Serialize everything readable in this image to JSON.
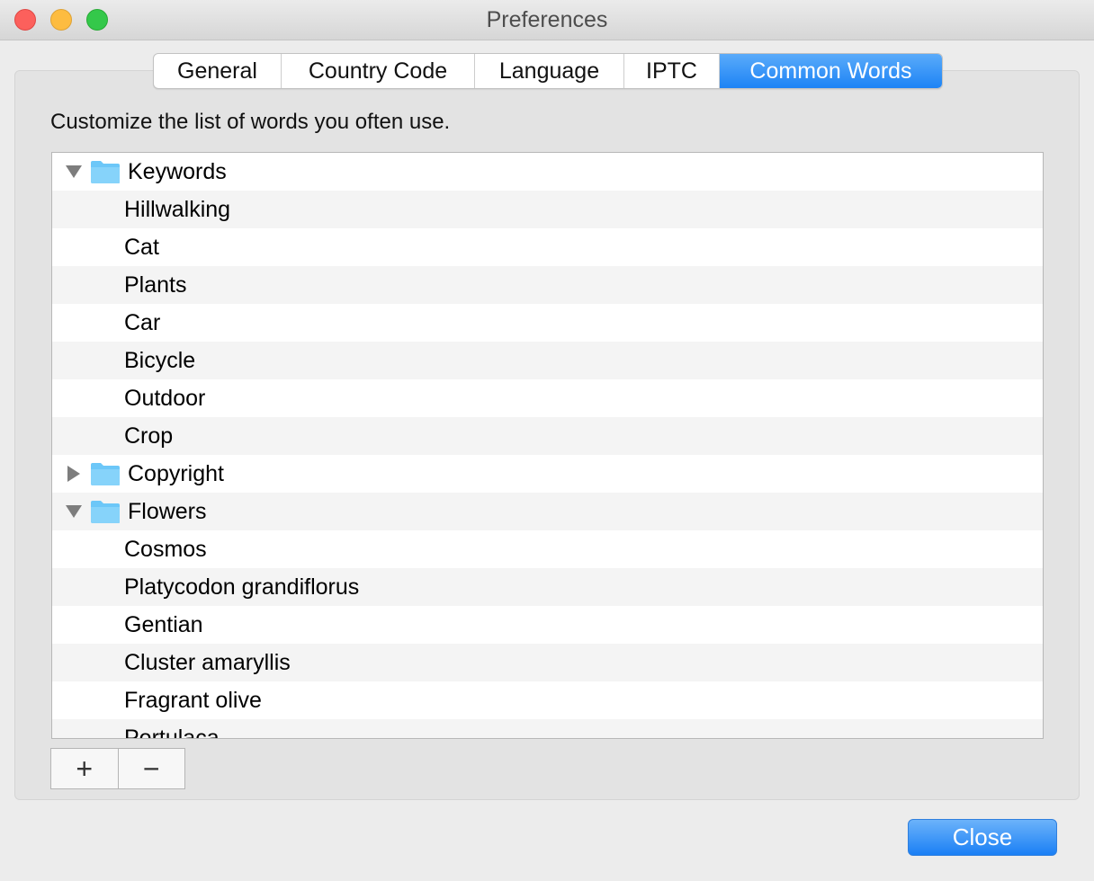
{
  "window": {
    "title": "Preferences"
  },
  "tabs": [
    {
      "label": "General"
    },
    {
      "label": "Country Code"
    },
    {
      "label": "Language"
    },
    {
      "label": "IPTC"
    },
    {
      "label": "Common Words",
      "selected": true
    }
  ],
  "description": "Customize the list of words you often use.",
  "list": {
    "groups": [
      {
        "label": "Keywords",
        "expanded": true,
        "items": [
          "Hillwalking",
          "Cat",
          "Plants",
          "Car",
          "Bicycle",
          "Outdoor",
          "Crop"
        ]
      },
      {
        "label": "Copyright",
        "expanded": false,
        "items": []
      },
      {
        "label": "Flowers",
        "expanded": true,
        "items": [
          "Cosmos",
          "Platycodon grandiflorus",
          "Gentian",
          "Cluster amaryllis",
          "Fragrant olive",
          "Portulaca"
        ]
      }
    ]
  },
  "buttons": {
    "add": "+",
    "remove": "−",
    "close": "Close"
  },
  "colors": {
    "accent": "#1d83f5",
    "folder": "#6cc7f8"
  }
}
